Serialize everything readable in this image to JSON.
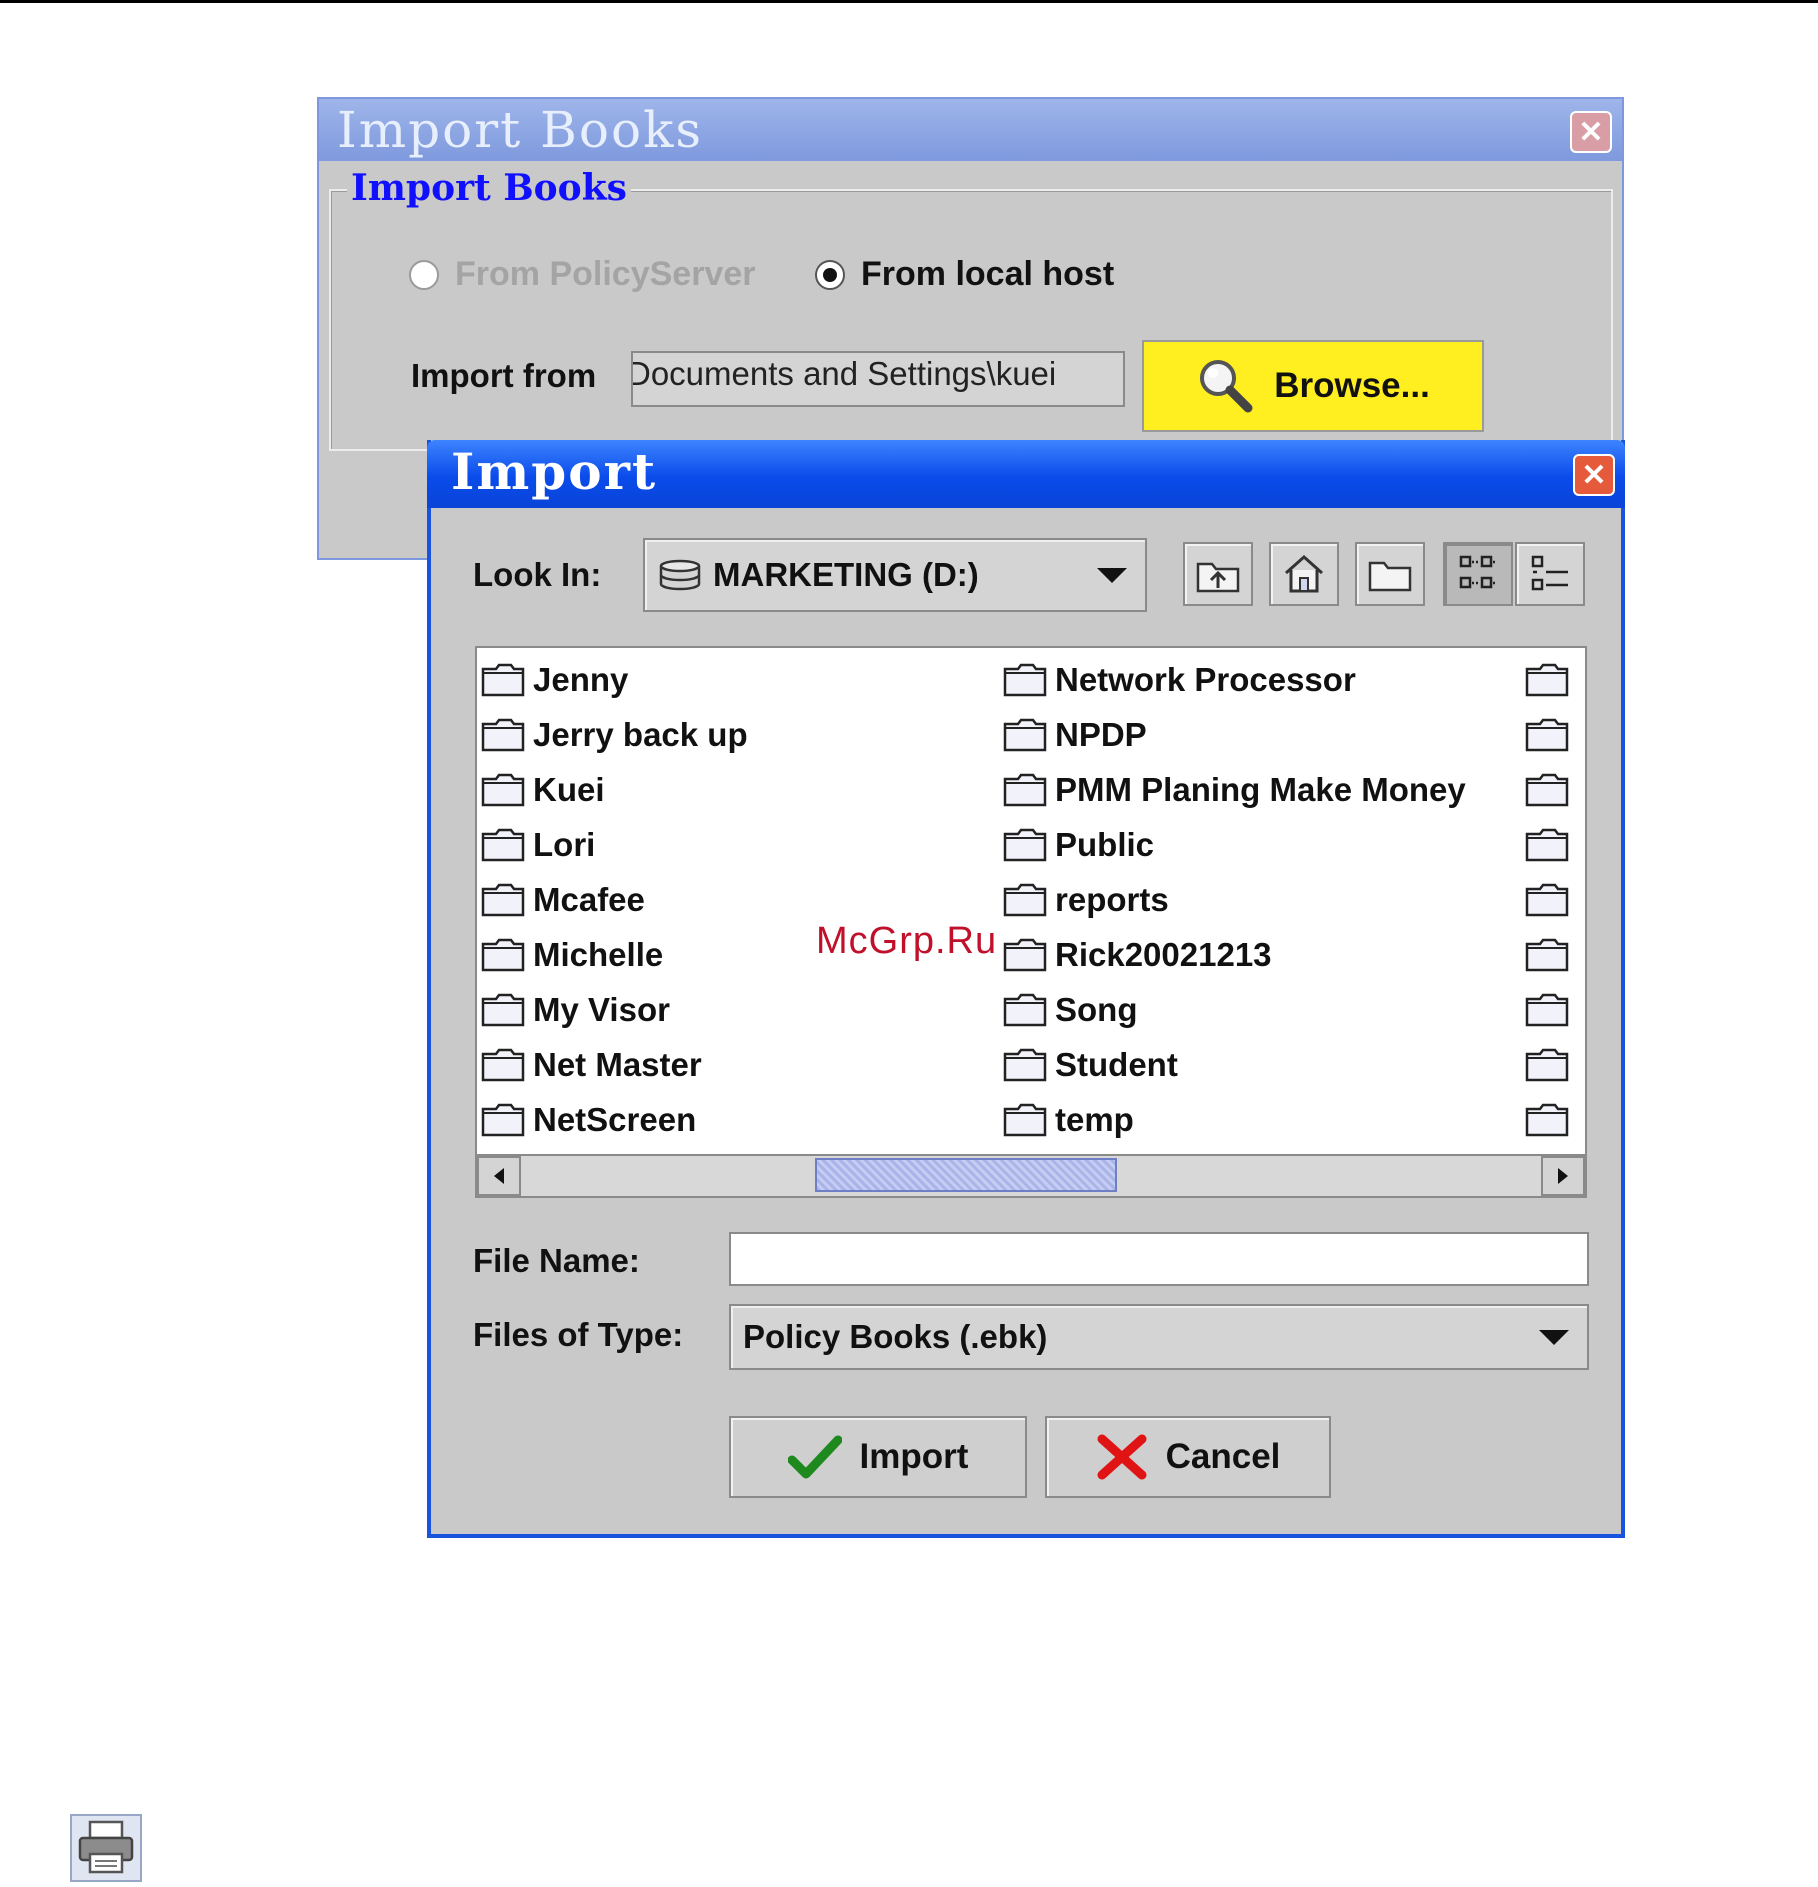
{
  "import_books": {
    "title": "Import Books",
    "group_label": "Import Books",
    "radio_policy_server": "From PolicyServer",
    "radio_local_host": "From local host",
    "selected_source": "From local host",
    "import_from_label": "Import from",
    "import_from_value": "Documents and Settings\\kuei",
    "browse_label": "Browse..."
  },
  "import_dialog": {
    "title": "Import",
    "look_in_label": "Look In:",
    "look_in_value": "MARKETING (D:)",
    "toolbar": [
      "up-folder-icon",
      "home-icon",
      "new-folder-icon",
      "list-view-icon",
      "details-view-icon"
    ],
    "files_col1": [
      "Jenny",
      "Jerry back up",
      "Kuei",
      "Lori",
      "Mcafee",
      "Michelle",
      "My Visor",
      "Net Master",
      "NetScreen"
    ],
    "files_col2": [
      "Network Processor",
      "NPDP",
      "PMM Planing Make Money",
      "Public",
      "reports",
      "Rick20021213",
      "Song",
      "Student",
      "temp"
    ],
    "file_name_label": "File Name:",
    "file_name_value": "",
    "files_of_type_label": "Files of Type:",
    "files_of_type_value": "Policy Books (.ebk)",
    "import_button": "Import",
    "cancel_button": "Cancel"
  },
  "watermark": "McGrp.Ru",
  "colors": {
    "browse_bg": "#ffee20",
    "dialog_title_bar": "#0a4bea",
    "legend_text": "#1010ff",
    "watermark": "#c0102a"
  }
}
